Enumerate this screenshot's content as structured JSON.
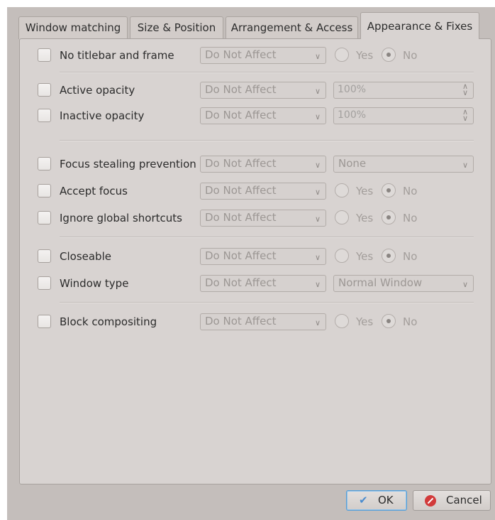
{
  "tabs": [
    {
      "label": "Window matching",
      "active": false
    },
    {
      "label": "Size & Position",
      "active": false
    },
    {
      "label": "Arrangement & Access",
      "active": false
    },
    {
      "label": "Appearance & Fixes",
      "active": true
    }
  ],
  "rows": [
    {
      "label": "No titlebar and frame",
      "policy": "Do Not Affect",
      "yes": "Yes",
      "no": "No",
      "selected": "No"
    },
    {
      "label": "Active opacity",
      "policy": "Do Not Affect",
      "value": "100%"
    },
    {
      "label": "Inactive opacity",
      "policy": "Do Not Affect",
      "value": "100%"
    },
    {
      "label": "Focus stealing prevention",
      "policy": "Do Not Affect",
      "value": "None"
    },
    {
      "label": "Accept focus",
      "policy": "Do Not Affect",
      "yes": "Yes",
      "no": "No",
      "selected": "No"
    },
    {
      "label": "Ignore global shortcuts",
      "policy": "Do Not Affect",
      "yes": "Yes",
      "no": "No",
      "selected": "No"
    },
    {
      "label": "Closeable",
      "policy": "Do Not Affect",
      "yes": "Yes",
      "no": "No",
      "selected": "No"
    },
    {
      "label": "Window type",
      "policy": "Do Not Affect",
      "value": "Normal Window"
    },
    {
      "label": "Block compositing",
      "policy": "Do Not Affect",
      "yes": "Yes",
      "no": "No",
      "selected": "No"
    }
  ],
  "buttons": {
    "ok": "OK",
    "cancel": "Cancel"
  },
  "icons": {
    "ok": "checkmark-icon",
    "cancel": "cancel-icon",
    "dropdown": "chevron-down-icon",
    "spin": "spin-arrows-icon"
  },
  "colors": {
    "dialog_bg": "#c4bebb",
    "panel_bg": "#d8d3d1",
    "focus_accent": "#5a9fd4",
    "cancel_red": "#d23a3a"
  }
}
